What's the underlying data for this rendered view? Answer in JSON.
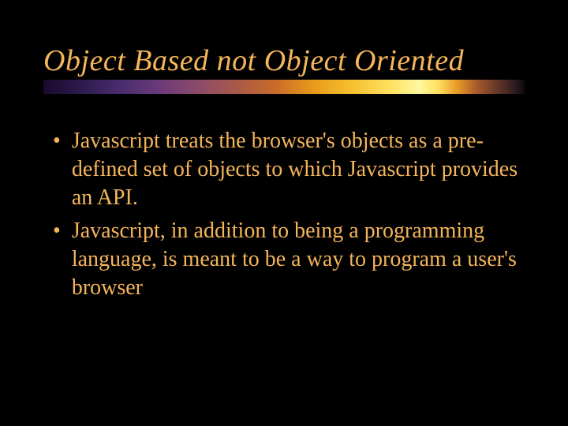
{
  "slide": {
    "title": "Object Based not Object Oriented",
    "bullets": [
      "Javascript treats the browser's objects as a pre-defined set of objects to which Javascript provides an API.",
      "Javascript, in addition to being a programming language, is meant to be a way to program a user's browser"
    ]
  }
}
